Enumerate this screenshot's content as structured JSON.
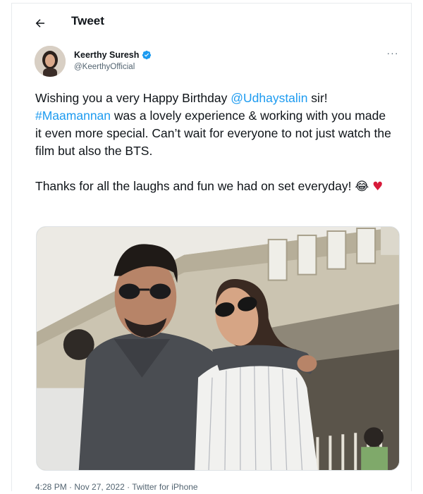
{
  "header": {
    "title": "Tweet",
    "back_icon": "arrow-left-icon"
  },
  "author": {
    "display_name": "Keerthy Suresh",
    "handle": "@KeerthyOfficial",
    "verified_icon": "verified-badge-icon",
    "more_icon": "more-horizontal-icon",
    "more_label": "···"
  },
  "tweet": {
    "line1_prefix": "Wishing you a very Happy Birthday ",
    "mention": "@Udhaystalin",
    "line1_suffix": " sir!",
    "hashtag": "#Maamannan",
    "body_rest": " was a lovely experience & working with you made it even more special. Can’t wait for everyone to not just watch the film but also the BTS.",
    "para2": "Thanks for all the laughs and fun we had on set everyday! ",
    "emoji_laugh": "😂",
    "emoji_heart": "♥"
  },
  "meta": {
    "time": "4:28 PM",
    "separator": " · ",
    "date": "Nov 27, 2022",
    "source": "Twitter for iPhone"
  },
  "colors": {
    "link": "#1d9bf0",
    "text": "#0f1419",
    "secondary": "#536471",
    "verified": "#1d9bf0",
    "heart": "#d71a3a"
  }
}
